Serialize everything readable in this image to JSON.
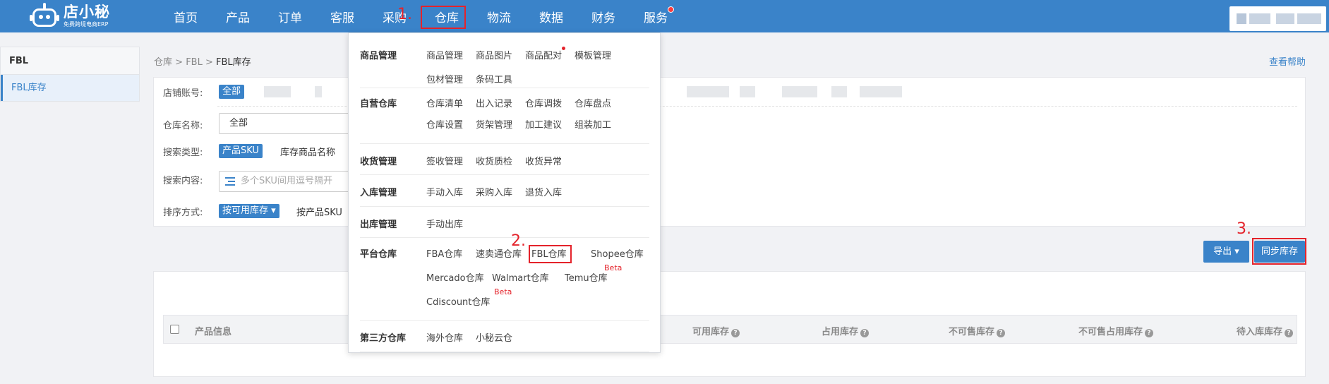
{
  "logo": {
    "name": "店小秘",
    "slogan": "免费跨境电商ERP"
  },
  "nav": {
    "items": [
      "首页",
      "产品",
      "订单",
      "客服",
      "采购",
      "仓库",
      "物流",
      "数据",
      "财务",
      "服务"
    ],
    "active": "仓库"
  },
  "steps": {
    "s1": "1.",
    "s2": "2.",
    "s3": "3."
  },
  "sidebar": {
    "title": "FBL",
    "item": "FBL库存"
  },
  "breadcrumb": {
    "a": "仓库",
    "sep1": ">",
    "b": "FBL",
    "sep2": ">",
    "c": "FBL库存"
  },
  "help": "查看帮助",
  "filter": {
    "shop_label": "店铺账号:",
    "shop_all": "全部",
    "warehouse_label": "仓库名称:",
    "warehouse_value": "全部",
    "search_type_label": "搜索类型:",
    "search_type_active": "产品SKU",
    "search_type_opt2": "库存商品名称",
    "search_label": "搜索内容:",
    "search_placeholder": "多个SKU间用逗号隔开",
    "sort_label": "排序方式:",
    "sort_active": "按可用库存 ▾",
    "sort_opt2": "按产品SKU"
  },
  "actions": {
    "export": "导出 ▾",
    "sync": "同步库存"
  },
  "table": {
    "headers": [
      "产品信息",
      "可用库存",
      "占用库存",
      "不可售库存",
      "不可售占用库存",
      "待入库库存"
    ]
  },
  "dropdown": {
    "groups": [
      {
        "title": "商品管理",
        "links": [
          "商品管理",
          "商品图片",
          "商品配对",
          "模板管理",
          "包材管理",
          "条码工具"
        ]
      },
      {
        "title": "自营仓库",
        "links": [
          "仓库清单",
          "出入记录",
          "仓库调拨",
          "仓库盘点",
          "仓库设置",
          "货架管理",
          "加工建议",
          "组装加工"
        ]
      },
      {
        "title": "收货管理",
        "links": [
          "签收管理",
          "收货质检",
          "收货异常"
        ]
      },
      {
        "title": "入库管理",
        "links": [
          "手动入库",
          "采购入库",
          "退货入库"
        ]
      },
      {
        "title": "出库管理",
        "links": [
          "手动出库"
        ]
      },
      {
        "title": "平台仓库",
        "links": [
          "FBA仓库",
          "速卖通仓库",
          "FBL仓库",
          "Shopee仓库",
          "Mercado仓库",
          "Walmart仓库",
          "Temu仓库",
          "Cdiscount仓库"
        ]
      },
      {
        "title": "第三方仓库",
        "links": [
          "海外仓库",
          "小秘云仓"
        ]
      }
    ],
    "beta": "Beta"
  },
  "colors": {
    "primary": "#3a83c9",
    "highlight": "#e4232b"
  }
}
